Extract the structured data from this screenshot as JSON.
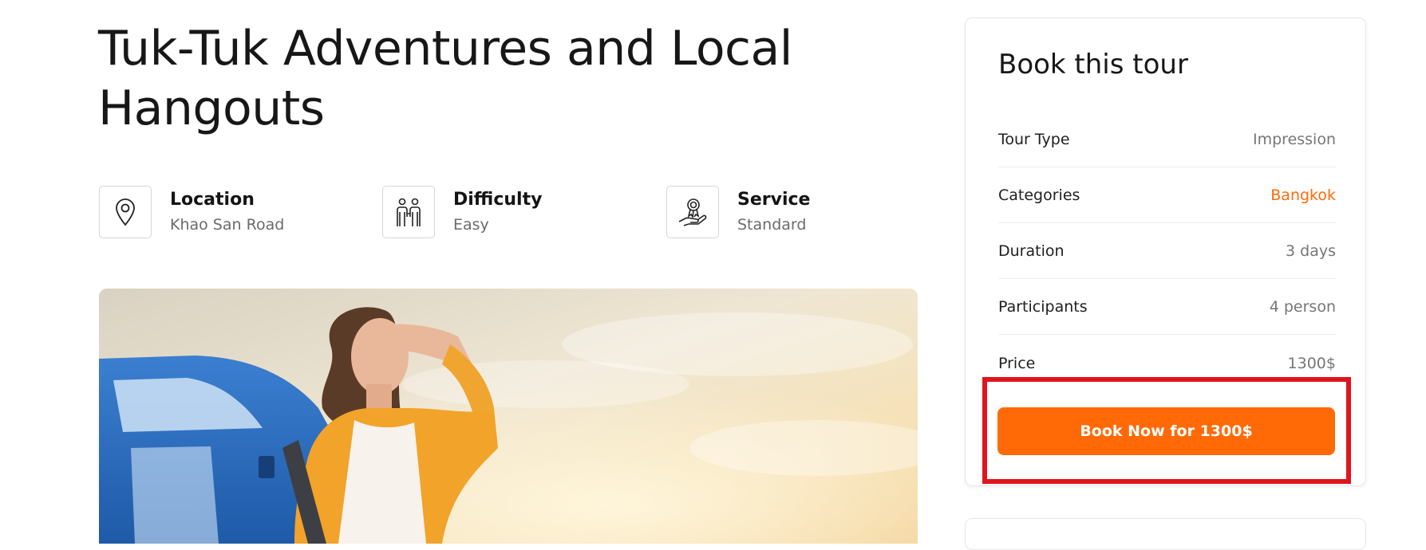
{
  "tour": {
    "title": "Tuk-Tuk Adventures and Local Hangouts"
  },
  "features": [
    {
      "label": "Location",
      "value": "Khao San Road",
      "icon": "map-pin-icon"
    },
    {
      "label": "Difficulty",
      "value": "Easy",
      "icon": "people-icon"
    },
    {
      "label": "Service",
      "value": "Standard",
      "icon": "award-hand-icon"
    }
  ],
  "booking": {
    "title": "Book this tour",
    "rows": [
      {
        "label": "Tour Type",
        "value": "Impression"
      },
      {
        "label": "Categories",
        "value": "Bangkok"
      },
      {
        "label": "Duration",
        "value": "3 days"
      },
      {
        "label": "Participants",
        "value": "4 person"
      },
      {
        "label": "Price",
        "value": "1300$"
      }
    ],
    "button_label": "Book Now for 1300$"
  },
  "colors": {
    "accent": "#ff6a07",
    "highlight": "#e0141d"
  }
}
